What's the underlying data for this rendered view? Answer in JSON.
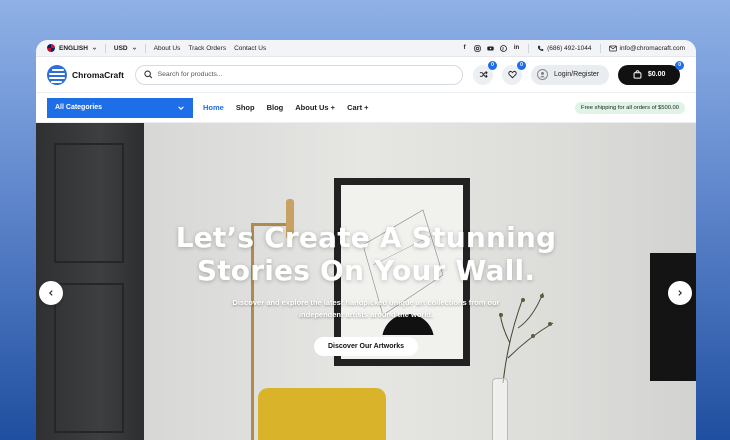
{
  "topbar": {
    "language": "ENGLISH",
    "currency": "USD",
    "links": [
      "About Us",
      "Track Orders",
      "Contact Us"
    ],
    "social_icons": [
      "facebook-icon",
      "instagram-icon",
      "youtube-icon",
      "pinterest-icon",
      "linkedin-icon"
    ],
    "phone": "(686) 492-1044",
    "email": "info@chromacraft.com"
  },
  "header": {
    "logo_text": "ChromaCraft",
    "search_placeholder": "Search for products...",
    "compare_count": "0",
    "wishlist_count": "0",
    "login_label": "Login/Register",
    "cart_total": "$0.00",
    "cart_count": "0"
  },
  "nav": {
    "categories_label": "All Categories",
    "items": [
      "Home",
      "Shop",
      "Blog",
      "About Us +",
      "Cart +"
    ],
    "active": "Home",
    "shipping_note": "Free shipping for all orders of $500.00"
  },
  "hero": {
    "title_line1": "Let’s Create A Stunning",
    "title_line2": "Stories On Your Wall.",
    "subtitle_line1": "Discover and explore the latest handpicked unique art collections from our",
    "subtitle_line2": "independent artists around the world.",
    "cta": "Discover Our Artworks"
  },
  "colors": {
    "accent": "#1e6ee8",
    "cart_bg": "#111111",
    "shipping_bg": "#dff3e6"
  }
}
